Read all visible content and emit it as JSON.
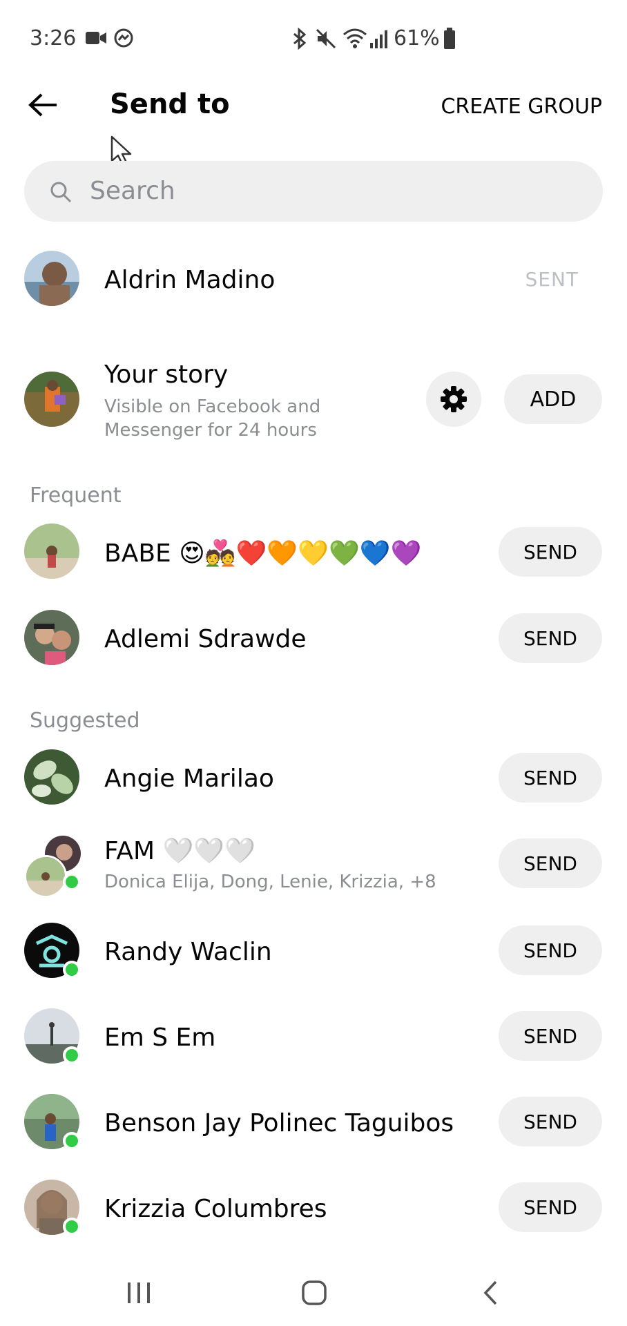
{
  "status_bar": {
    "time": "3:26",
    "battery": "61%",
    "icons": [
      "video-icon",
      "messenger-icon",
      "bluetooth-icon",
      "mute-icon",
      "wifi-icon",
      "signal-icon",
      "battery-icon"
    ]
  },
  "header": {
    "title": "Send to",
    "create_group": "CREATE GROUP"
  },
  "search": {
    "placeholder": "Search"
  },
  "sent_row": {
    "name": "Aldrin Madino",
    "status": "SENT"
  },
  "story": {
    "title": "Your story",
    "subtitle_line1": "Visible on Facebook and",
    "subtitle_line2": "Messenger for 24 hours",
    "add_label": "ADD"
  },
  "sections": {
    "frequent": "Frequent",
    "suggested": "Suggested"
  },
  "frequent": [
    {
      "name": "BABE 😍💑❤️🧡💛💚💙💜",
      "action": "SEND"
    },
    {
      "name": "Adlemi Sdrawde",
      "action": "SEND"
    }
  ],
  "suggested": [
    {
      "name": "Angie Marilao",
      "action": "SEND"
    },
    {
      "name": "FAM 🤍🤍🤍",
      "subtitle": "Donica Elija, Dong, Lenie, Krizzia, +8",
      "action": "SEND"
    },
    {
      "name": "Randy Waclin",
      "action": "SEND"
    },
    {
      "name": "Em S Em",
      "action": "SEND"
    },
    {
      "name": "Benson Jay Polinec Taguibos",
      "action": "SEND"
    },
    {
      "name": "Krizzia Columbres",
      "action": "SEND"
    }
  ],
  "colors": {
    "online": "#31cc46",
    "pill_bg": "#efefef",
    "secondary_text": "#8a8d91"
  }
}
